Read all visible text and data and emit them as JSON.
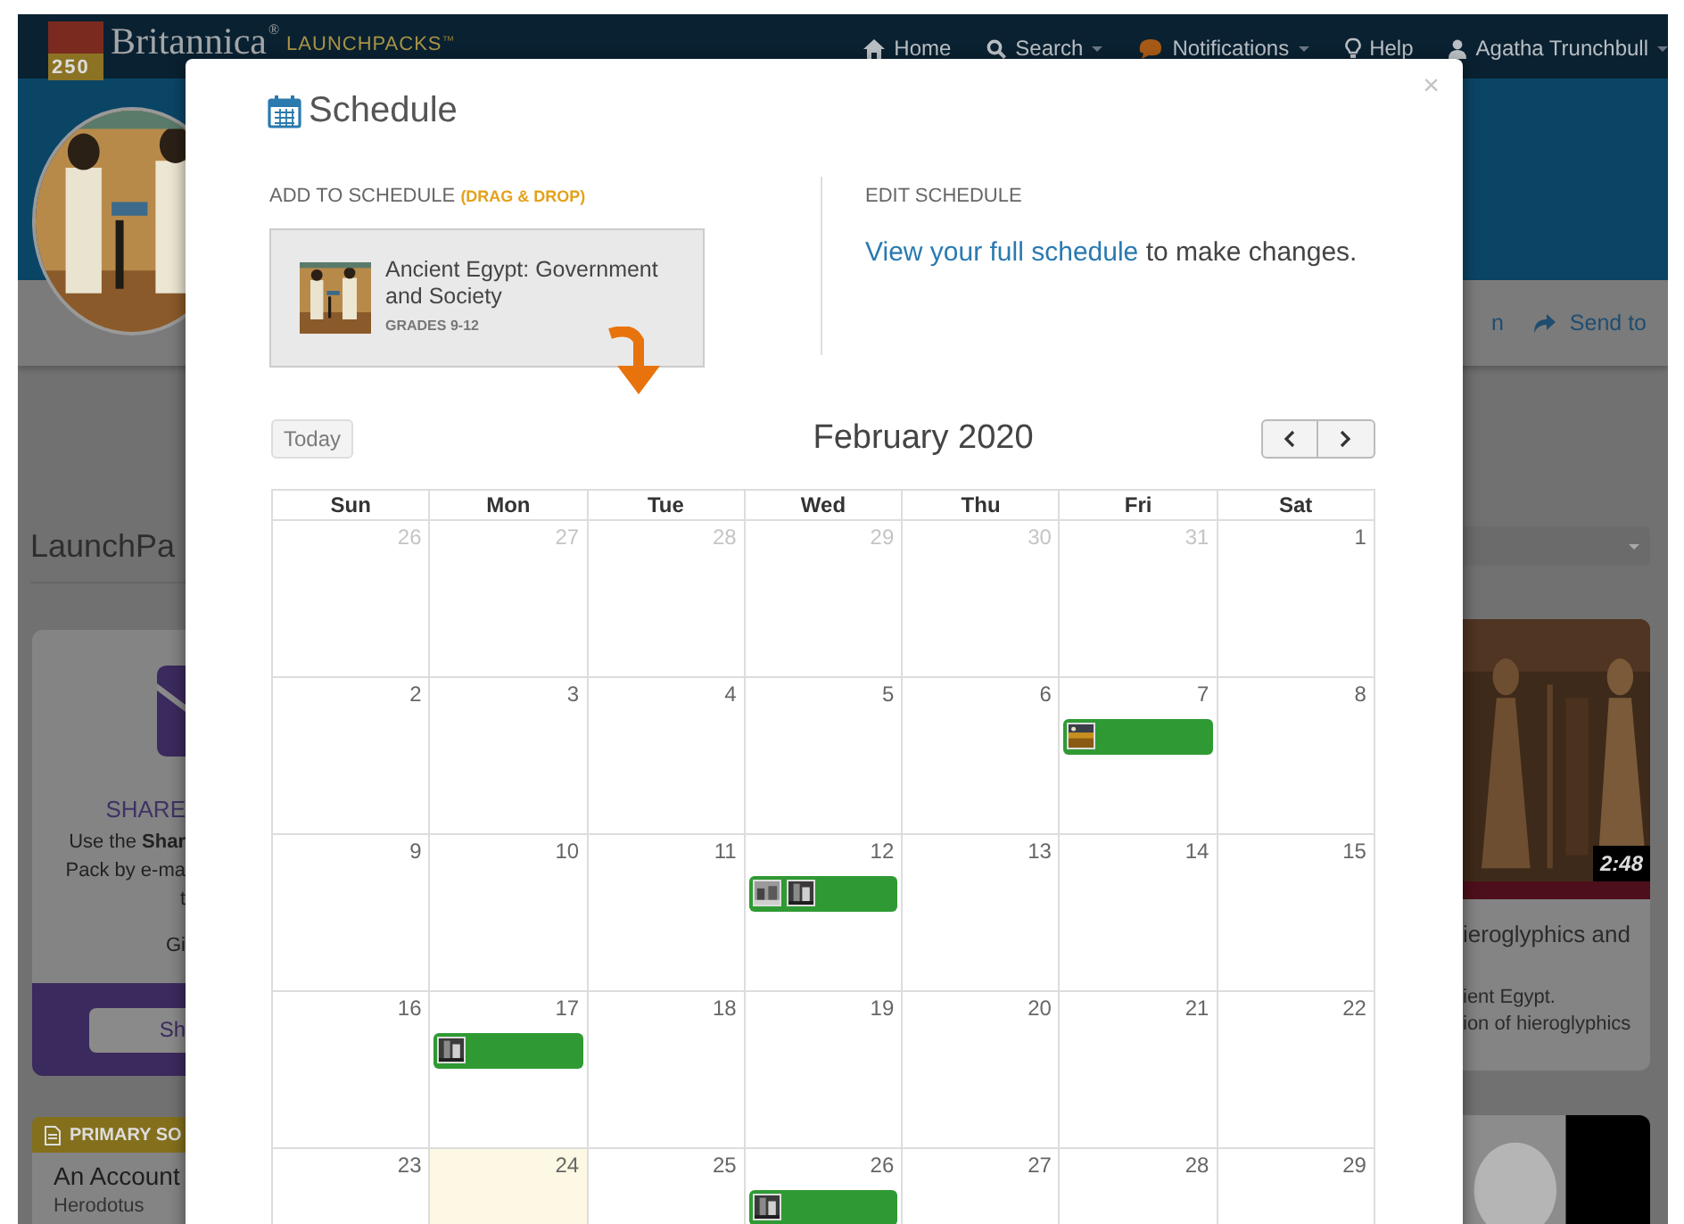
{
  "navbar": {
    "brand": {
      "anniversary": "250",
      "name": "Britannica",
      "registered": "®",
      "product": "LAUNCHPACKS",
      "trademark": "™"
    },
    "items": [
      {
        "kind": "home",
        "label": "Home",
        "dropdown": false
      },
      {
        "kind": "search",
        "label": "Search",
        "dropdown": true
      },
      {
        "kind": "notifications",
        "label": "Notifications",
        "dropdown": true
      },
      {
        "kind": "help",
        "label": "Help",
        "dropdown": false
      },
      {
        "kind": "user",
        "label": "Agatha Trunchbull",
        "dropdown": true
      }
    ]
  },
  "toolbar": {
    "items": [
      {
        "kind": "plain",
        "label": "n"
      },
      {
        "kind": "send",
        "label": "Send to"
      }
    ]
  },
  "left": {
    "heading": "LaunchPa",
    "share_card": {
      "title": "SHARE",
      "lines": [
        "Use the **Shar**",
        "Pack by e-ma",
        "t",
        "Gi"
      ],
      "button": "Sh"
    },
    "source_card": {
      "badge": "PRIMARY SO",
      "title": "An Account",
      "author": "Herodotus"
    }
  },
  "right": {
    "video_card": {
      "duration": "2:48",
      "title": "ieroglyphics and",
      "lines": [
        "ient Egypt.",
        "ion of hieroglyphics"
      ]
    }
  },
  "modal": {
    "title": "Schedule",
    "close": "×",
    "add": {
      "label": "ADD TO SCHEDULE",
      "hint": "(DRAG & DROP)",
      "item": {
        "title": "Ancient Egypt: Government and Society",
        "grades": "GRADES 9-12"
      }
    },
    "edit": {
      "label": "EDIT SCHEDULE",
      "link": "View your full schedule",
      "text": "to make changes."
    },
    "calendar": {
      "today_button": "Today",
      "today_button_disabled": true,
      "title": "February 2020",
      "weekdays": [
        "Sun",
        "Mon",
        "Tue",
        "Wed",
        "Thu",
        "Fri",
        "Sat"
      ],
      "weeks": [
        [
          {
            "date": "26",
            "other_month": true,
            "today": false
          },
          {
            "date": "27",
            "other_month": true,
            "today": false
          },
          {
            "date": "28",
            "other_month": true,
            "today": false
          },
          {
            "date": "29",
            "other_month": true,
            "today": false
          },
          {
            "date": "30",
            "other_month": true,
            "today": false
          },
          {
            "date": "31",
            "other_month": true,
            "today": false
          },
          {
            "date": "1",
            "other_month": false,
            "today": false
          }
        ],
        [
          {
            "date": "2",
            "other_month": false,
            "today": false
          },
          {
            "date": "3",
            "other_month": false,
            "today": false
          },
          {
            "date": "4",
            "other_month": false,
            "today": false
          },
          {
            "date": "5",
            "other_month": false,
            "today": false
          },
          {
            "date": "6",
            "other_month": false,
            "today": false
          },
          {
            "date": "7",
            "other_month": false,
            "today": false
          },
          {
            "date": "8",
            "other_month": false,
            "today": false
          }
        ],
        [
          {
            "date": "9",
            "other_month": false,
            "today": false
          },
          {
            "date": "10",
            "other_month": false,
            "today": false
          },
          {
            "date": "11",
            "other_month": false,
            "today": false
          },
          {
            "date": "12",
            "other_month": false,
            "today": false
          },
          {
            "date": "13",
            "other_month": false,
            "today": false
          },
          {
            "date": "14",
            "other_month": false,
            "today": false
          },
          {
            "date": "15",
            "other_month": false,
            "today": false
          }
        ],
        [
          {
            "date": "16",
            "other_month": false,
            "today": false
          },
          {
            "date": "17",
            "other_month": false,
            "today": false
          },
          {
            "date": "18",
            "other_month": false,
            "today": false
          },
          {
            "date": "19",
            "other_month": false,
            "today": false
          },
          {
            "date": "20",
            "other_month": false,
            "today": false
          },
          {
            "date": "21",
            "other_month": false,
            "today": false
          },
          {
            "date": "22",
            "other_month": false,
            "today": false
          }
        ],
        [
          {
            "date": "23",
            "other_month": false,
            "today": false
          },
          {
            "date": "24",
            "other_month": false,
            "today": true
          },
          {
            "date": "25",
            "other_month": false,
            "today": false
          },
          {
            "date": "26",
            "other_month": false,
            "today": false
          },
          {
            "date": "27",
            "other_month": false,
            "today": false
          },
          {
            "date": "28",
            "other_month": false,
            "today": false
          },
          {
            "date": "29",
            "other_month": false,
            "today": false
          }
        ]
      ]
    }
  }
}
